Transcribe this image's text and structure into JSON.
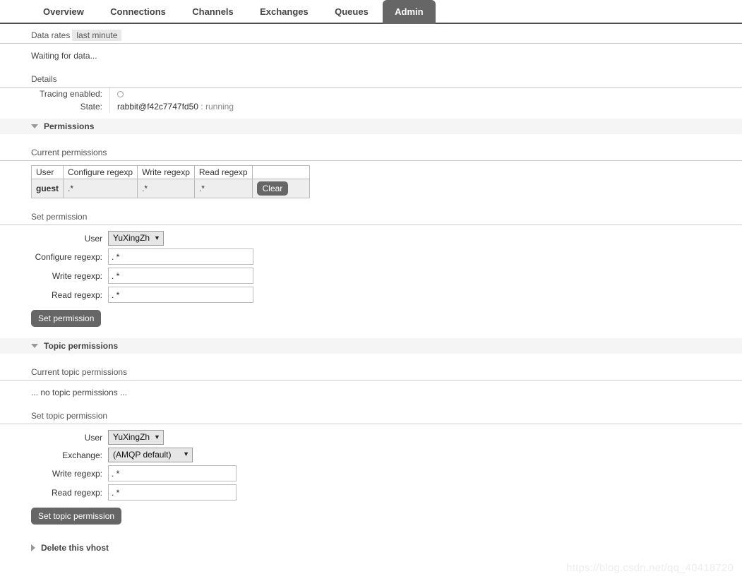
{
  "nav": {
    "tabs": [
      {
        "label": "Overview",
        "active": false
      },
      {
        "label": "Connections",
        "active": false
      },
      {
        "label": "Channels",
        "active": false
      },
      {
        "label": "Exchanges",
        "active": false
      },
      {
        "label": "Queues",
        "active": false
      },
      {
        "label": "Admin",
        "active": true
      }
    ]
  },
  "data_rates": {
    "label": "Data rates",
    "period": "last minute",
    "status": "Waiting for data..."
  },
  "details": {
    "label": "Details",
    "rows": [
      {
        "key": "Tracing enabled:",
        "value": "",
        "type": "radio"
      },
      {
        "key": "State:",
        "value": "rabbit@f42c7747fd50",
        "separator": ":",
        "state": "running",
        "type": "text"
      }
    ]
  },
  "permissions": {
    "header": "Permissions",
    "expanded": true,
    "current_label": "Current permissions",
    "table": {
      "columns": [
        "User",
        "Configure regexp",
        "Write regexp",
        "Read regexp",
        ""
      ],
      "rows": [
        {
          "user": "guest",
          "configure": ".*",
          "write": ".*",
          "read": ".*",
          "action": "Clear"
        }
      ]
    },
    "set_label": "Set permission",
    "form": {
      "user_label": "User",
      "user_value": "YuXingZh",
      "configure_label": "Configure regexp:",
      "configure_value": ". *",
      "write_label": "Write regexp:",
      "write_value": ". *",
      "read_label": "Read regexp:",
      "read_value": ". *",
      "submit_label": "Set permission"
    }
  },
  "topic_permissions": {
    "header": "Topic permissions",
    "expanded": true,
    "current_label": "Current topic permissions",
    "empty_message": "... no topic permissions ...",
    "set_label": "Set topic permission",
    "form": {
      "user_label": "User",
      "user_value": "YuXingZh",
      "exchange_label": "Exchange:",
      "exchange_value": "(AMQP default)",
      "write_label": "Write regexp:",
      "write_value": ". *",
      "read_label": "Read regexp:",
      "read_value": ". *",
      "submit_label": "Set topic permission"
    }
  },
  "delete_vhost": {
    "header": "Delete this vhost",
    "expanded": false
  },
  "watermark": {
    "text": "https://blog.csdn.net/qq_40418720"
  },
  "colors": {
    "accent": "#666666",
    "band": "#f5f5f5",
    "rule": "#cccccc",
    "text": "#333333",
    "muted": "#888888"
  }
}
